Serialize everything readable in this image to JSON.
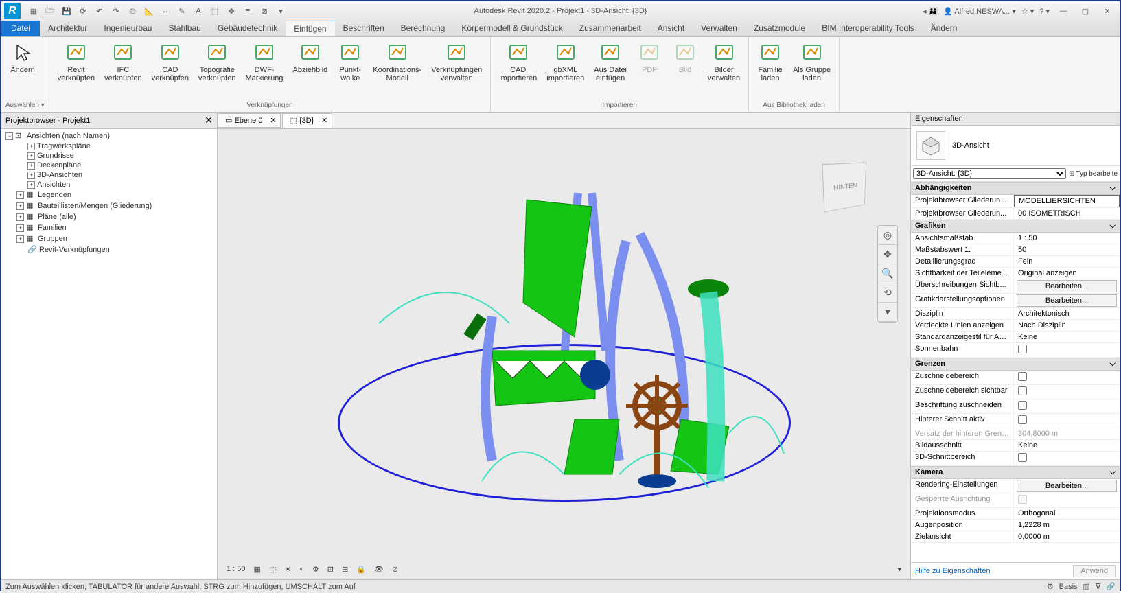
{
  "title": "Autodesk Revit 2020.2 - Projekt1 - 3D-Ansicht: {3D}",
  "user": "Alfred.NESWA...",
  "file_label": "Datei",
  "menutabs": [
    "Architektur",
    "Ingenieurbau",
    "Stahlbau",
    "Gebäudetechnik",
    "Einfügen",
    "Beschriften",
    "Berechnung",
    "Körpermodell & Grundstück",
    "Zusammenarbeit",
    "Ansicht",
    "Verwalten",
    "Zusatzmodule",
    "BIM Interoperability Tools",
    "Ändern"
  ],
  "active_tab_index": 4,
  "ribbon": {
    "groups": [
      {
        "label": "Auswählen ▾",
        "buttons": [
          {
            "t": "Ändern",
            "sub": ""
          }
        ]
      },
      {
        "label": "Verknüpfungen",
        "buttons": [
          {
            "t": "Revit",
            "sub": "verknüpfen"
          },
          {
            "t": "IFC",
            "sub": "verknüpfen"
          },
          {
            "t": "CAD",
            "sub": "verknüpfen"
          },
          {
            "t": "Topografie",
            "sub": "verknüpfen"
          },
          {
            "t": "DWF-",
            "sub": "Markierung"
          },
          {
            "t": "Abziehbild",
            "sub": ""
          },
          {
            "t": "Punkt-",
            "sub": "wolke"
          },
          {
            "t": "Koordinations-",
            "sub": "Modell"
          },
          {
            "t": "Verknüpfungen",
            "sub": "verwalten"
          }
        ]
      },
      {
        "label": "Importieren",
        "buttons": [
          {
            "t": "CAD",
            "sub": "importieren"
          },
          {
            "t": "gbXML",
            "sub": "importieren"
          },
          {
            "t": "Aus Datei",
            "sub": "einfügen"
          },
          {
            "t": "PDF",
            "sub": "",
            "disabled": true
          },
          {
            "t": "Bild",
            "sub": "",
            "disabled": true
          },
          {
            "t": "Bilder",
            "sub": "verwalten"
          }
        ]
      },
      {
        "label": "Aus Bibliothek laden",
        "buttons": [
          {
            "t": "Familie",
            "sub": "laden"
          },
          {
            "t": "Als Gruppe",
            "sub": "laden"
          }
        ]
      }
    ]
  },
  "projbrowser": {
    "title": "Projektbrowser - Projekt1",
    "root": "Ansichten (nach Namen)",
    "lvl2": [
      "Tragwerkspläne",
      "Grundrisse",
      "Deckenpläne",
      "3D-Ansichten",
      "Ansichten"
    ],
    "lvl1": [
      "Legenden",
      "Bauteillisten/Mengen (Gliederung)",
      "Pläne (alle)",
      "Familien",
      "Gruppen",
      "Revit-Verknüpfungen"
    ]
  },
  "doctabs": [
    {
      "icon": "level",
      "label": "Ebene 0"
    },
    {
      "icon": "3d",
      "label": "{3D}",
      "active": true
    }
  ],
  "viewcube": "HINTEN",
  "viewcontrol": {
    "scale": "1 : 50"
  },
  "props": {
    "title": "Eigenschaften",
    "typeName": "3D-Ansicht",
    "selector": "3D-Ansicht: {3D}",
    "editType": "Typ bearbeite",
    "sections": [
      {
        "name": "Abhängigkeiten",
        "rows": [
          {
            "k": "Projektbrowser Gliederun...",
            "v": "MODELLIERSICHTEN",
            "input": true
          },
          {
            "k": "Projektbrowser Gliederun...",
            "v": "00 ISOMETRISCH"
          }
        ]
      },
      {
        "name": "Grafiken",
        "rows": [
          {
            "k": "Ansichtsmaßstab",
            "v": "1 : 50"
          },
          {
            "k": "Maßstabswert 1:",
            "v": "50"
          },
          {
            "k": "Detaillierungsgrad",
            "v": "Fein"
          },
          {
            "k": "Sichtbarkeit der Teileleme...",
            "v": "Original anzeigen"
          },
          {
            "k": "Überschreibungen Sichtb...",
            "v": "Bearbeiten...",
            "btn": true
          },
          {
            "k": "Grafikdarstellungsoptionen",
            "v": "Bearbeiten...",
            "btn": true
          },
          {
            "k": "Disziplin",
            "v": "Architektonisch"
          },
          {
            "k": "Verdeckte Linien anzeigen",
            "v": "Nach Disziplin"
          },
          {
            "k": "Standardanzeigestil für An...",
            "v": "Keine"
          },
          {
            "k": "Sonnenbahn",
            "v": "",
            "check": false
          }
        ]
      },
      {
        "name": "Grenzen",
        "rows": [
          {
            "k": "Zuschneidebereich",
            "v": "",
            "check": false
          },
          {
            "k": "Zuschneidebereich sichtbar",
            "v": "",
            "check": false
          },
          {
            "k": "Beschriftung zuschneiden",
            "v": "",
            "check": false
          },
          {
            "k": "Hinterer Schnitt aktiv",
            "v": "",
            "check": false
          },
          {
            "k": "Versatz der hinteren Grenze",
            "v": "304,8000 m",
            "disabled": true
          },
          {
            "k": "Bildausschnitt",
            "v": "Keine"
          },
          {
            "k": "3D-Schnittbereich",
            "v": "",
            "check": false
          }
        ]
      },
      {
        "name": "Kamera",
        "rows": [
          {
            "k": "Rendering-Einstellungen",
            "v": "Bearbeiten...",
            "btn": true
          },
          {
            "k": "Gesperrte Ausrichtung",
            "v": "",
            "check": false,
            "disabled": true
          },
          {
            "k": "Projektionsmodus",
            "v": "Orthogonal"
          },
          {
            "k": "Augenposition",
            "v": "1,2228 m"
          },
          {
            "k": "Zielansicht",
            "v": "0,0000 m"
          }
        ]
      }
    ],
    "helplink": "Hilfe zu Eigenschaften",
    "apply": "Anwend"
  },
  "status": {
    "left": "Zum Auswählen klicken, TABULATOR für andere Auswahl, STRG zum Hinzufügen, UMSCHALT zum Auf",
    "mid": "Basis"
  }
}
